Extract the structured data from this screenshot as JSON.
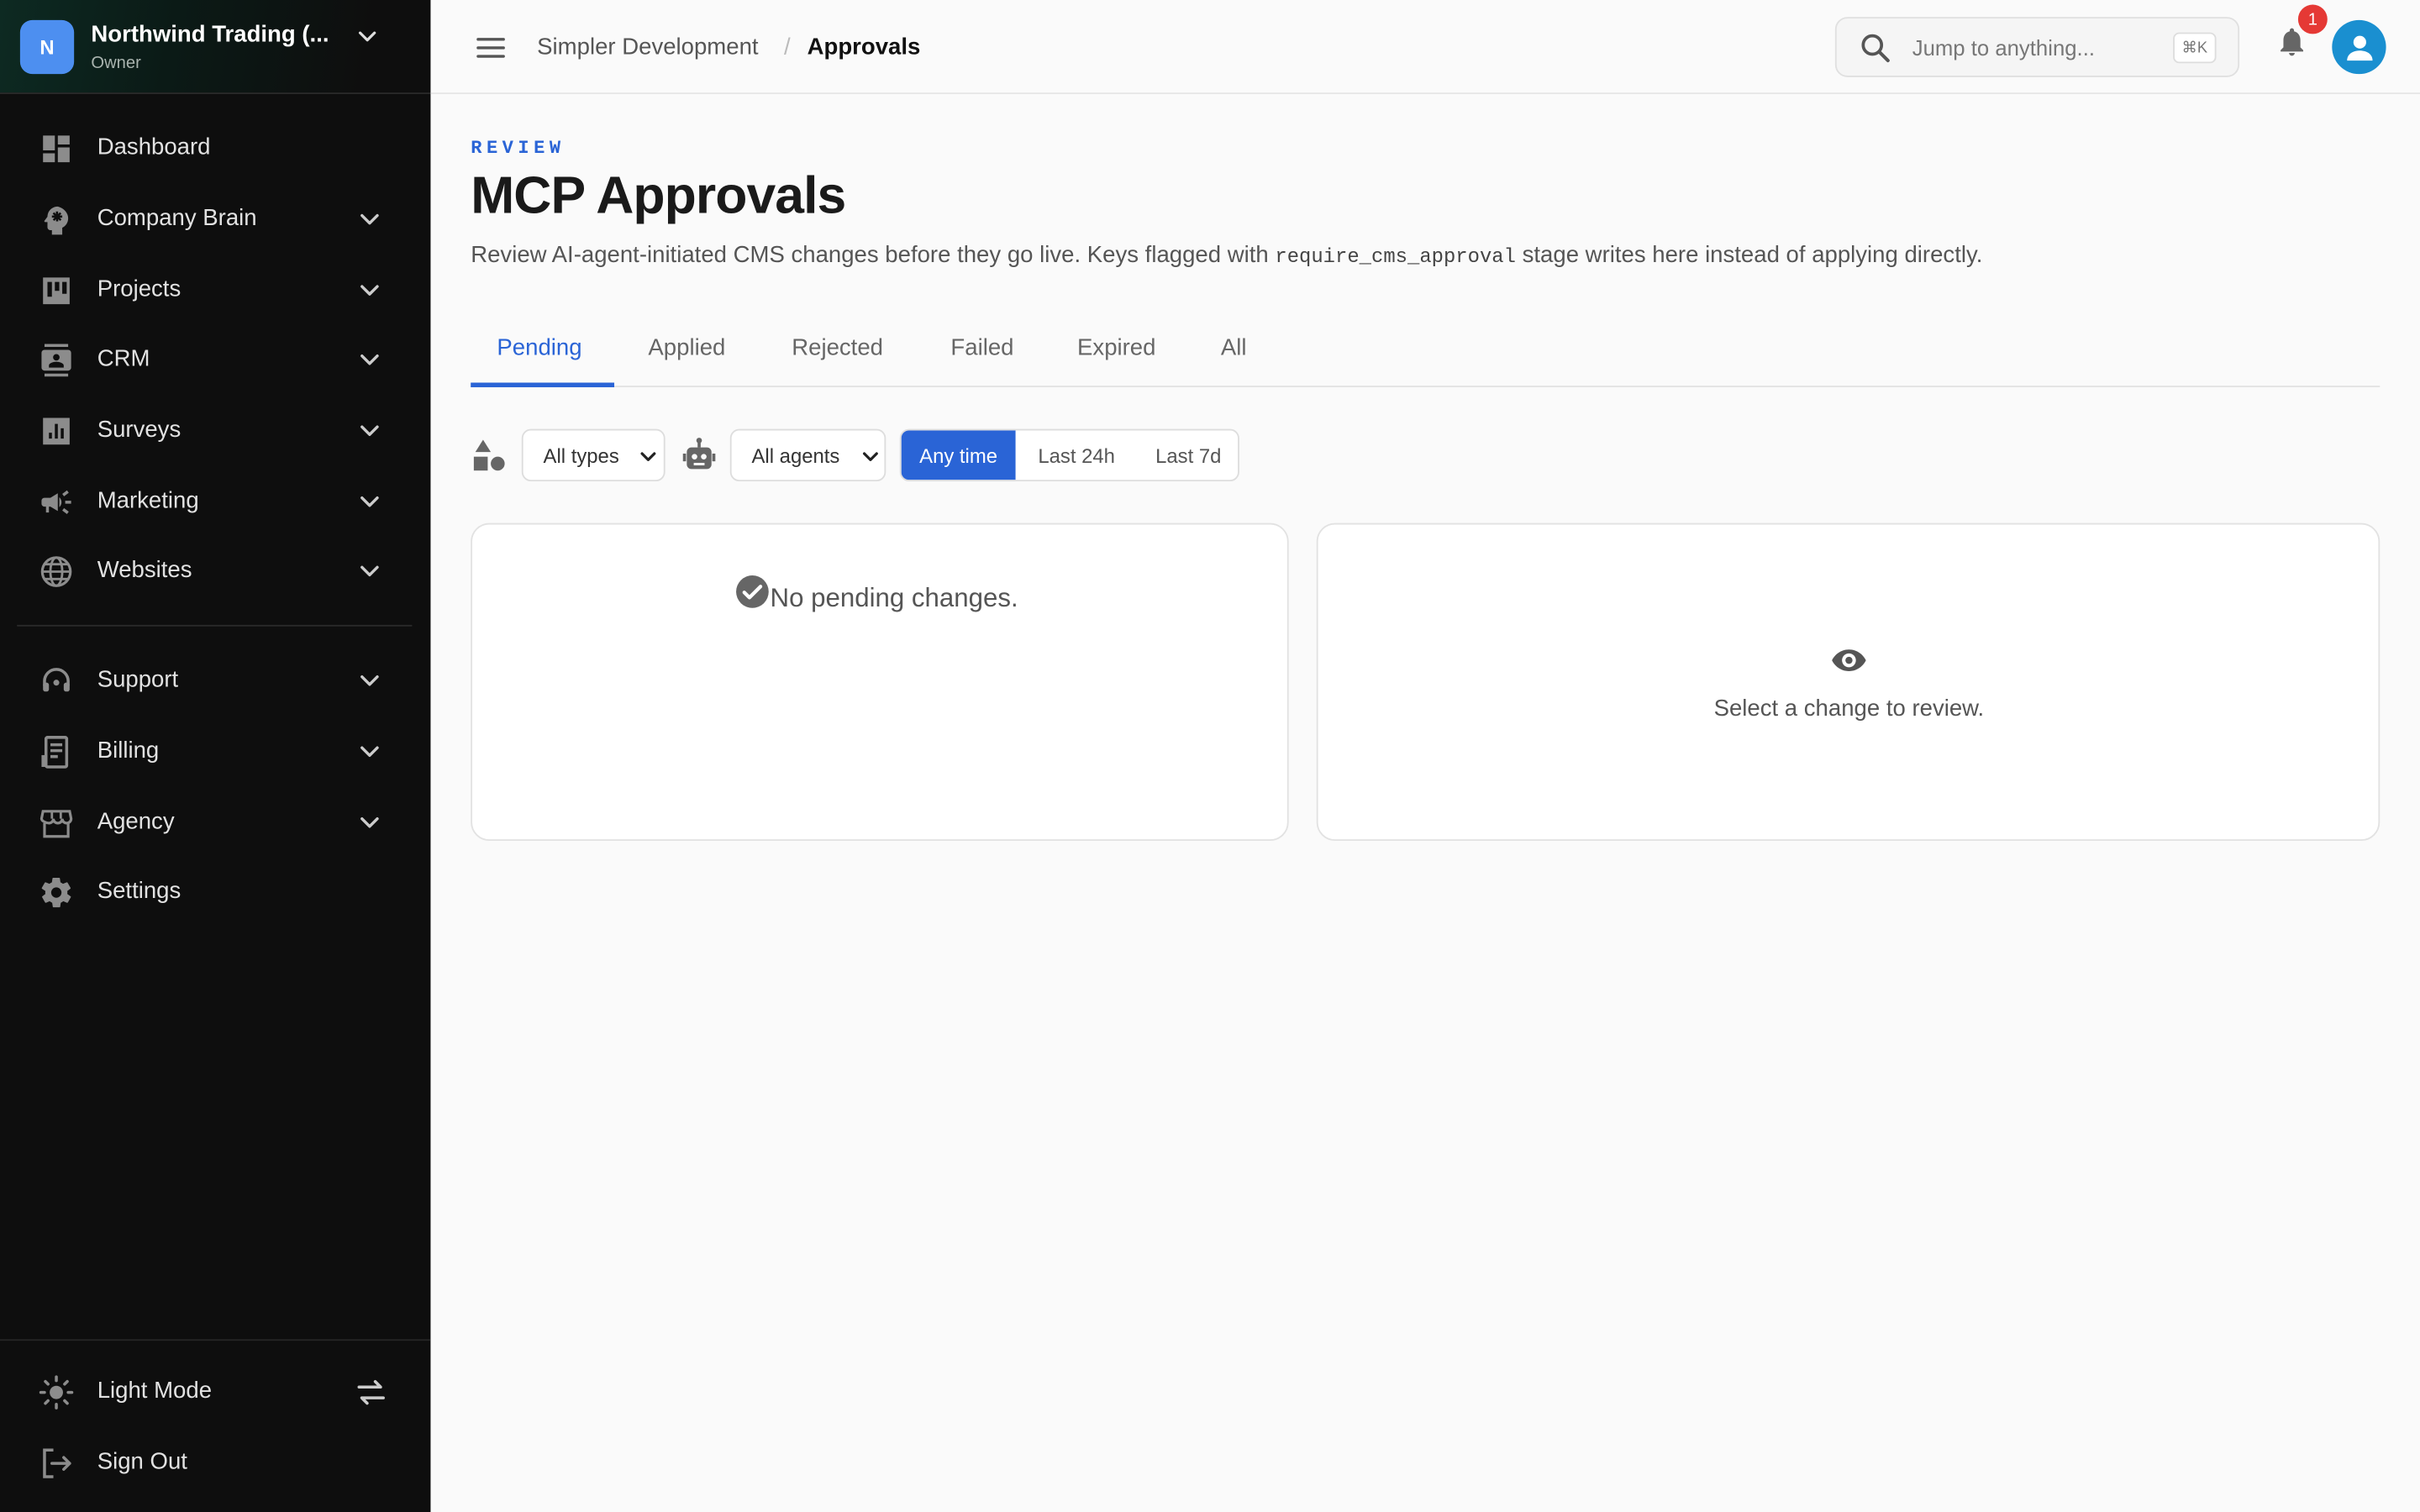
{
  "org": {
    "initial": "N",
    "name": "Northwind Trading (...",
    "role": "Owner"
  },
  "nav": {
    "items": [
      {
        "label": "Dashboard",
        "icon": "dashboard-icon",
        "chevron": false
      },
      {
        "label": "Company Brain",
        "icon": "brain-icon",
        "chevron": true
      },
      {
        "label": "Projects",
        "icon": "kanban-icon",
        "chevron": true
      },
      {
        "label": "CRM",
        "icon": "contacts-icon",
        "chevron": true
      },
      {
        "label": "Surveys",
        "icon": "poll-icon",
        "chevron": true
      },
      {
        "label": "Marketing",
        "icon": "megaphone-icon",
        "chevron": true
      },
      {
        "label": "Websites",
        "icon": "globe-icon",
        "chevron": true
      },
      {
        "label": "Support",
        "icon": "headset-icon",
        "chevron": true
      },
      {
        "label": "Billing",
        "icon": "receipt-icon",
        "chevron": true
      },
      {
        "label": "Agency",
        "icon": "storefront-icon",
        "chevron": true
      },
      {
        "label": "Settings",
        "icon": "gear-icon",
        "chevron": false
      }
    ],
    "light_mode": "Light Mode",
    "sign_out": "Sign Out"
  },
  "topbar": {
    "crumb_parent": "Simpler Development",
    "crumb_sep": "/",
    "crumb_current": "Approvals",
    "search_placeholder": "Jump to anything...",
    "search_shortcut": "⌘K",
    "notification_count": "1"
  },
  "page": {
    "eyebrow": "REVIEW",
    "title": "MCP Approvals",
    "desc_before": "Review AI-agent-initiated CMS changes before they go live. Keys flagged with ",
    "desc_code": "require_cms_approval",
    "desc_after": " stage writes here instead of applying directly."
  },
  "tabs": [
    "Pending",
    "Applied",
    "Rejected",
    "Failed",
    "Expired",
    "All"
  ],
  "active_tab": "Pending",
  "filters": {
    "type_select": "All types",
    "agent_select": "All agents",
    "time_range": [
      "Any time",
      "Last 24h",
      "Last 7d"
    ],
    "time_selected": "Any time"
  },
  "list_panel": {
    "empty_text": "No pending changes."
  },
  "detail_panel": {
    "empty_text": "Select a change to review."
  },
  "colors": {
    "accent": "#2a64d6",
    "sidebar_bg": "#0e0e0e",
    "badge": "#e53935",
    "org_avatar": "#4d8ff0",
    "user_avatar": "#1a8fd0"
  }
}
